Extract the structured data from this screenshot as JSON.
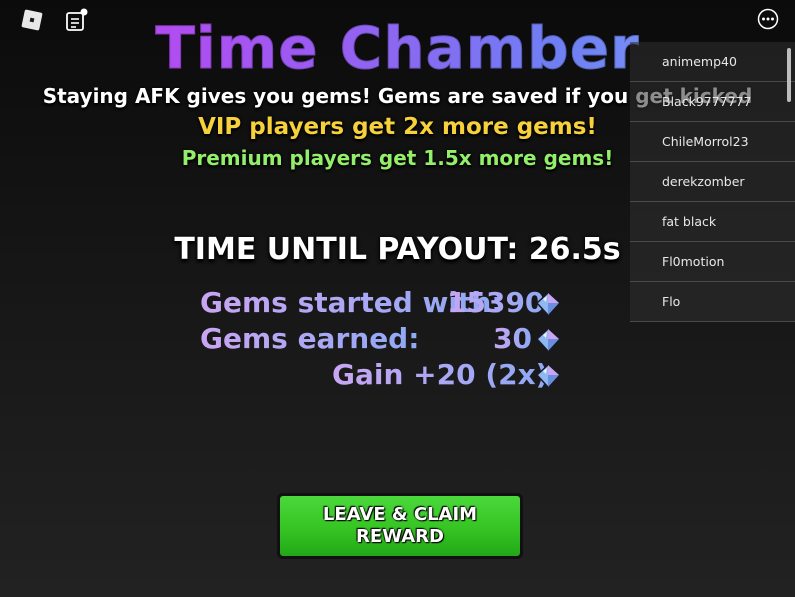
{
  "title": "Time Chamber",
  "subtitles": {
    "afk": "Staying AFK gives you gems! Gems are saved if you get kicked",
    "vip": "VIP players get 2x more gems!",
    "premium": "Premium players get 1.5x more gems!"
  },
  "payout": "TIME UNTIL PAYOUT: 26.5s",
  "gems": {
    "started_label": "Gems started with:",
    "started_value": "15390",
    "earned_label": "Gems earned:",
    "earned_value": "30",
    "gain": "Gain +20 (2x)"
  },
  "claim_button": "LEAVE & CLAIM\nREWARD",
  "players": [
    "animemp40",
    "Black9777777",
    "ChileMorrol23",
    "derekzomber",
    "fat black",
    "Fl0motion",
    "Flo"
  ],
  "icons": {
    "logo": "roblox-logo-icon",
    "chat": "chat-icon",
    "more": "more-options-icon",
    "gem": "gem-icon"
  },
  "colors": {
    "vip": "#f6d13b",
    "premium": "#93ef6a",
    "button": "#36c423"
  }
}
